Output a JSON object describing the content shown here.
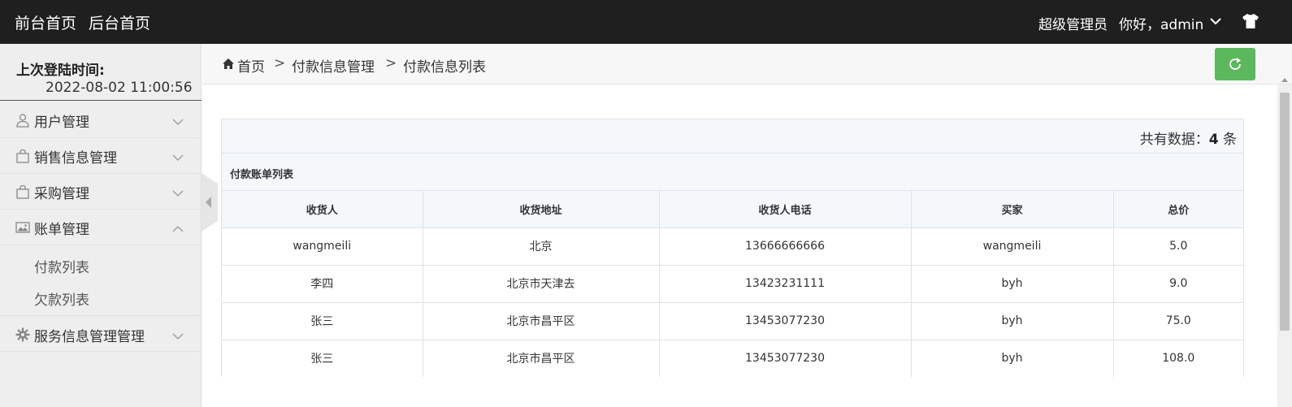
{
  "topbar": {
    "front_home": "前台首页",
    "back_home": "后台首页",
    "role": "超级管理员",
    "greeting": "你好，admin",
    "caret_icon": "chevron-down-icon",
    "theme_icon": "tshirt-icon"
  },
  "sidebar": {
    "last_login_label": "上次登陆时间:",
    "last_login_time": "2022-08-02 11:00:56",
    "items": [
      {
        "label": "用户管理",
        "icon": "user-icon",
        "expanded": false
      },
      {
        "label": "销售信息管理",
        "icon": "shopping-bag-icon",
        "expanded": false
      },
      {
        "label": "采购管理",
        "icon": "shopping-bag-icon",
        "expanded": false
      },
      {
        "label": "账单管理",
        "icon": "image-icon",
        "expanded": true
      },
      {
        "label": "服务信息管理管理",
        "icon": "gear-icon",
        "expanded": false
      }
    ],
    "submenu": [
      "付款列表",
      "欠款列表"
    ]
  },
  "breadcrumb": {
    "home": "首页",
    "sep": ">",
    "level1": "付款信息管理",
    "level2": "付款信息列表"
  },
  "colors": {
    "topbar_bg": "#1f1f1f",
    "refresh_button": "#5cb85c",
    "panel_header_bg": "#f4f8fb"
  },
  "panel": {
    "count_prefix": "共有数据：",
    "count_value": "4",
    "count_suffix": " 条",
    "title": "付款账单列表",
    "columns": [
      "收货人",
      "收货地址",
      "收货人电话",
      "买家",
      "总价"
    ],
    "rows": [
      [
        "wangmeili",
        "北京",
        "13666666666",
        "wangmeili",
        "5.0"
      ],
      [
        "李四",
        "北京市天津去",
        "13423231111",
        "byh",
        "9.0"
      ],
      [
        "张三",
        "北京市昌平区",
        "13453077230",
        "byh",
        "75.0"
      ],
      [
        "张三",
        "北京市昌平区",
        "13453077230",
        "byh",
        "108.0"
      ]
    ]
  }
}
